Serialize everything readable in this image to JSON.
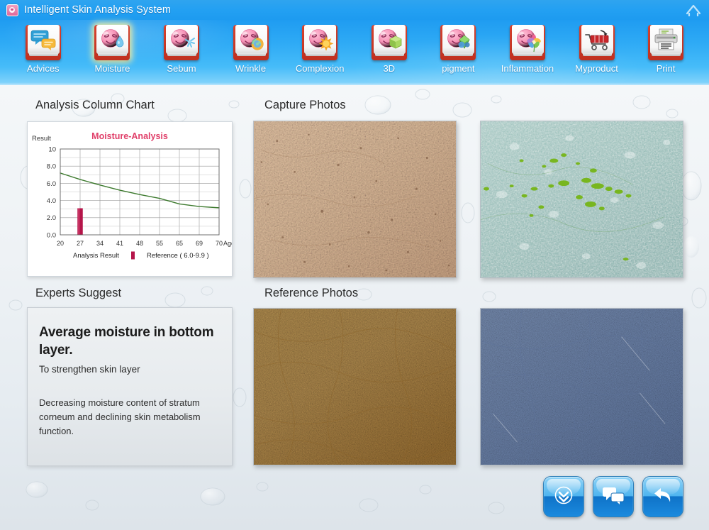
{
  "window": {
    "title": "Intelligent Skin Analysis System",
    "logo_icon": "app-logo-icon",
    "home_icon": "home-icon"
  },
  "toolbar": {
    "items": [
      {
        "label": "Advices",
        "icon": "speech-bubbles-book-icon",
        "active": false
      },
      {
        "label": "Moisture",
        "icon": "face-droplet-book-icon",
        "active": true
      },
      {
        "label": "Sebum",
        "icon": "face-splash-book-icon",
        "active": false
      },
      {
        "label": "Wrinkle",
        "icon": "face-swirl-book-icon",
        "active": false
      },
      {
        "label": "Complexion",
        "icon": "face-sun-book-icon",
        "active": false
      },
      {
        "label": "3D",
        "icon": "face-cube-book-icon",
        "active": false
      },
      {
        "label": "pigment",
        "icon": "face-gem-book-icon",
        "active": false
      },
      {
        "label": "Inflammation",
        "icon": "face-flower-book-icon",
        "active": false
      },
      {
        "label": "Myproduct",
        "icon": "shopping-cart-book-icon",
        "active": false
      },
      {
        "label": "Print",
        "icon": "printer-book-icon",
        "active": false
      }
    ]
  },
  "sections": {
    "chart_title": "Analysis Column Chart",
    "capture_title": "Capture Photos",
    "experts_title": "Experts Suggest",
    "reference_title": "Reference Photos"
  },
  "experts": {
    "heading": "Average moisture in bottom layer.",
    "subheading": "To strengthen skin layer",
    "body": "Decreasing moisture content of stratum corneum and declining skin metabolism function."
  },
  "photos": {
    "capture": [
      {
        "name": "capture-photo-skin-normal",
        "description": "tan skin surface with pores"
      },
      {
        "name": "capture-photo-skin-uv",
        "description": "teal UV skin image with green spots"
      }
    ],
    "reference": [
      {
        "name": "reference-photo-golden",
        "description": "golden textured skin reference"
      },
      {
        "name": "reference-photo-blue",
        "description": "blue textured skin reference"
      }
    ]
  },
  "actions": [
    {
      "name": "download-button",
      "icon": "double-chevron-down-circle-icon"
    },
    {
      "name": "comment-button",
      "icon": "speech-bubbles-icon"
    },
    {
      "name": "back-button",
      "icon": "back-arrow-icon"
    }
  ],
  "colors": {
    "titlebar": "#1d9bf0",
    "toolbar_top": "#1f9cf1",
    "chart_title": "#e0406a",
    "chart_line": "#3d7a2e",
    "chart_bar": "#b5154a",
    "book_red": "#c0301f"
  },
  "chart_data": {
    "type": "bar",
    "title": "Moisture-Analysis",
    "xlabel": "Age",
    "ylabel": "Result",
    "x_ticks": [
      "20",
      "27",
      "34",
      "41",
      "48",
      "55",
      "65",
      "69",
      "70"
    ],
    "y_ticks": [
      "0.0",
      "2.0",
      "4.0",
      "6.0",
      "8.0",
      "10"
    ],
    "ylim": [
      0,
      10
    ],
    "grid": true,
    "categories": [
      "20",
      "27",
      "34",
      "41",
      "48",
      "55",
      "65",
      "69",
      "70"
    ],
    "values": [
      null,
      3.1,
      null,
      null,
      null,
      null,
      null,
      null,
      null
    ],
    "series": [
      {
        "name": "Analysis Result",
        "type": "bar",
        "color": "#b5154a",
        "x": [
          "27"
        ],
        "values": [
          3.1
        ]
      },
      {
        "name": "Reference ( 6.0-9.9 )",
        "type": "line",
        "color": "#3d7a2e",
        "x": [
          "20",
          "27",
          "34",
          "41",
          "48",
          "55",
          "65",
          "69",
          "70"
        ],
        "values": [
          7.2,
          6.45,
          5.8,
          5.2,
          4.7,
          4.25,
          3.6,
          3.3,
          3.15
        ]
      }
    ],
    "legend": [
      {
        "label": "Analysis Result",
        "swatch": "#b5154a",
        "shape": "bar"
      },
      {
        "label": "Reference ( 6.0-9.9 )",
        "swatch": "#3d7a2e",
        "shape": "none"
      }
    ],
    "legend_position": "bottom"
  }
}
